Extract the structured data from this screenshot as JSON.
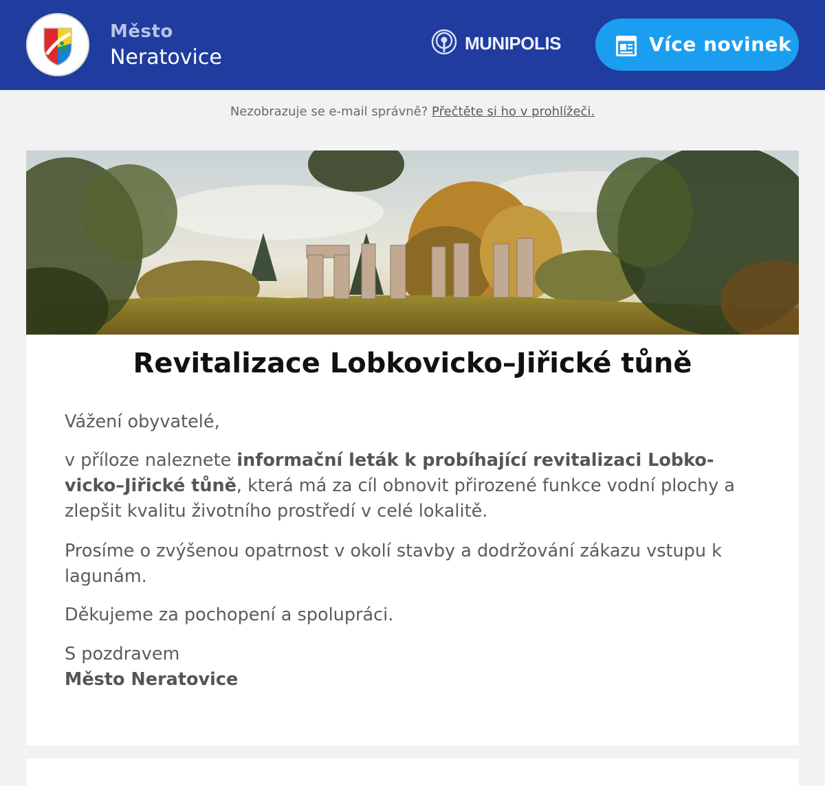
{
  "header": {
    "city_small": "Město",
    "city_name": "Neratovice",
    "brand": "MUNIPOLIS",
    "more_button_label": "Více novinek",
    "background_color": "#1f3c9e",
    "button_color": "#1b9ef0"
  },
  "browser_notice": {
    "text": "Nezobrazuje se e-mail správně?",
    "link": "Přečtěte si ho v prohlížeči."
  },
  "article": {
    "title": "Revitalizace Lobkovicko–Jiřické tůně",
    "greeting": "Vážení obyvatelé,",
    "p1_before": "v příloze naleznete ",
    "p1_bold": "informační leták k probíhající revitalizaci Lobko-vicko–Jiřické tůně",
    "p1_after": ", která má za cíl obnovit přirozené funkce vodní plochy a zlepšit kvalitu životního prostředí v celé lokalitě.",
    "p2": "Prosíme o zvýšenou opatrnost v okolí stavby a dodržování zákazu vstupu k lagunám.",
    "p3": "Děkujeme za pochopení a spolupráci.",
    "closing": "S pozdravem",
    "signature": "Město Neratovice"
  },
  "icons": {
    "logo": "city-coat-of-arms-icon",
    "brand": "broadcast-icon",
    "button": "newspaper-icon"
  }
}
